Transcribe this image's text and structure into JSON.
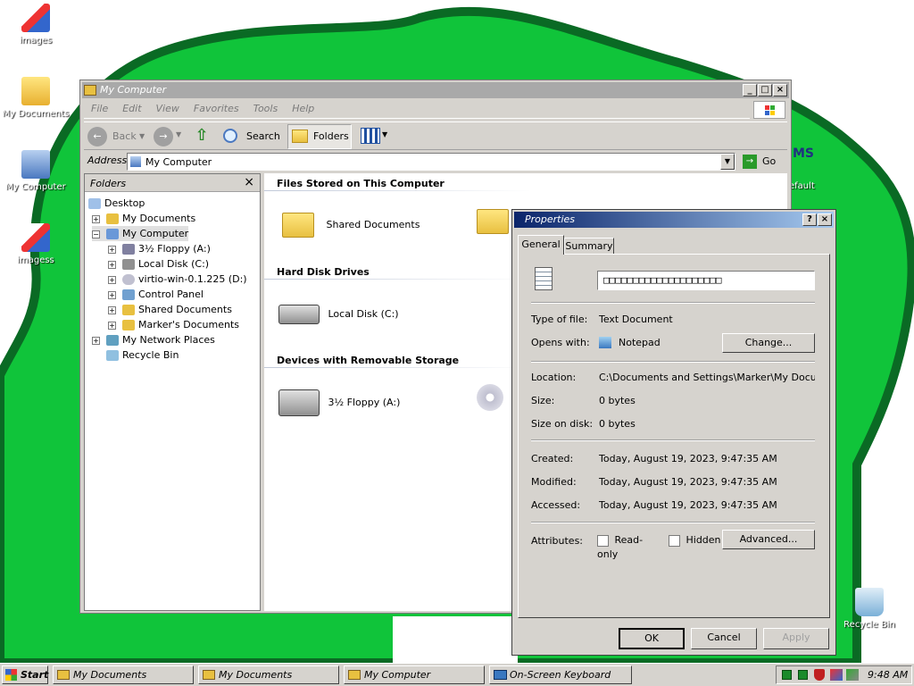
{
  "desktop": {
    "icons": [
      {
        "label": "images",
        "icon": "image-file-icon"
      },
      {
        "label": "My Documents",
        "icon": "my-documents-icon"
      },
      {
        "label": "My Computer",
        "icon": "my-computer-icon"
      },
      {
        "label": "imagess",
        "icon": "image-file-icon"
      },
      {
        "label": "Recycle Bin",
        "icon": "recycle-bin-icon"
      }
    ],
    "partial_text": [
      "MS",
      "efault"
    ],
    "colors": {
      "blob": "#0fc83c",
      "blob_border": "#0a6a24"
    }
  },
  "explorer": {
    "title": "My Computer",
    "menu": [
      "File",
      "Edit",
      "View",
      "Favorites",
      "Tools",
      "Help"
    ],
    "toolbar": {
      "back": "Back",
      "search": "Search",
      "folders": "Folders"
    },
    "address_label": "Address",
    "address_value": "My Computer",
    "go": "Go",
    "folders_pane_title": "Folders",
    "tree": {
      "desktop": "Desktop",
      "my_documents": "My Documents",
      "my_computer": "My Computer",
      "floppy": "3½ Floppy (A:)",
      "local_disk": "Local Disk (C:)",
      "virtio": "virtio-win-0.1.225 (D:)",
      "control_panel": "Control Panel",
      "shared_docs": "Shared Documents",
      "markers_docs": "Marker's Documents",
      "network": "My Network Places",
      "recycle": "Recycle Bin"
    },
    "sections": {
      "files": "Files Stored on This Computer",
      "hdd": "Hard Disk Drives",
      "removable": "Devices with Removable Storage"
    },
    "items": {
      "shared_docs": "Shared Documents",
      "local_disk": "Local Disk (C:)",
      "floppy": "3½ Floppy (A:)"
    }
  },
  "props": {
    "title": "Properties",
    "title_btns": {
      "help": "?",
      "close": "×"
    },
    "tabs": {
      "general": "General",
      "summary": "Summary"
    },
    "name_value": "□□□□□□□□□□□□□□□□□□□□",
    "labels": {
      "type": "Type of file:",
      "opens": "Opens with:",
      "location": "Location:",
      "size": "Size:",
      "size_disk": "Size on disk:",
      "created": "Created:",
      "modified": "Modified:",
      "accessed": "Accessed:",
      "attributes": "Attributes:"
    },
    "values": {
      "type": "Text Document",
      "opens": "Notepad",
      "location": "C:\\Documents and Settings\\Marker\\My Documents",
      "size": "0 bytes",
      "size_disk": "0 bytes",
      "created": "Today, August 19, 2023, 9:47:35 AM",
      "modified": "Today, August 19, 2023, 9:47:35 AM",
      "accessed": "Today, August 19, 2023, 9:47:35 AM"
    },
    "buttons": {
      "change": "Change...",
      "advanced": "Advanced...",
      "ok": "OK",
      "cancel": "Cancel",
      "apply": "Apply"
    },
    "checks": {
      "readonly": "Read-only",
      "hidden": "Hidden"
    }
  },
  "taskbar": {
    "start": "Start",
    "tasks": [
      "My Documents",
      "My Documents",
      "My Computer",
      "On-Screen Keyboard"
    ],
    "clock": "9:48 AM"
  }
}
